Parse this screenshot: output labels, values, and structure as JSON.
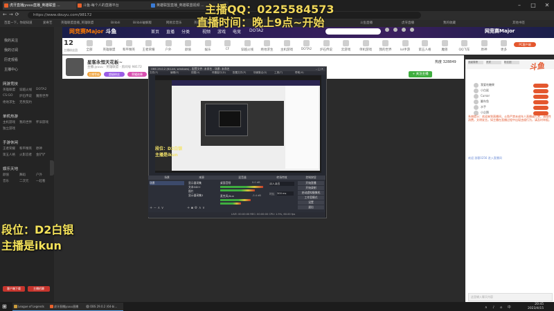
{
  "browser": {
    "tabs": [
      "虎牙直播jyuuu直播_英雄联盟 ...",
      "斗鱼-每个人的直播平台",
      "英雄联盟直播_英雄联盟视频 ..."
    ],
    "url": "https://www.douyu.com/98172",
    "bookmarks": [
      "百度一下，你就知道",
      "爱奇艺",
      "英雄联盟直播_英雄联盟",
      "Bilibili",
      "Bilibili破解版",
      "网易云音乐",
      "英雄联盟官方网站",
      "斗鱼直播",
      "虎牙直播",
      "我的收藏",
      "其他书签"
    ]
  },
  "site": {
    "logo_main": "斗鱼",
    "logo_sub": "网竞赛Major",
    "nav": [
      "首页",
      "直播",
      "分类",
      "视频",
      "游戏",
      "电竞",
      "DOTA2"
    ],
    "right_logo": "网竞赛Major"
  },
  "categories": {
    "count": "12",
    "count_sub": "主播粉丝团",
    "items": [
      "全部",
      "英雄联盟",
      "和平精英",
      "王者荣耀",
      "户外",
      "颜值",
      "娱乐",
      "CF",
      "穿越火线",
      "绝地求生",
      "主机游戏",
      "DOTA2",
      "炉石传说",
      "云游戏",
      "单机游戏",
      "我的世界",
      "lol手游",
      "第五人格",
      "魔兽",
      "QQ飞车",
      "原神",
      "更多"
    ],
    "promo": "PC客户端"
  },
  "overlay": {
    "qq_line": "主播QQ：0225584573",
    "time_line": "直播时间：晚上9点~开始",
    "rank_line": "段位：D2白银",
    "host_line": "主播是ikun"
  },
  "sidebar": {
    "top": [
      "我的关注",
      "我的订阅",
      "历史观看",
      "主播中心"
    ],
    "sections": [
      {
        "title": "网游竞技",
        "items": [
          "英雄联盟",
          "穿越火线",
          "DOTA2",
          "CS:GO",
          "炉石传说",
          "魔兽世界",
          "绝地求生",
          "无畏契约"
        ]
      },
      {
        "title": "单机热游",
        "items": [
          "主机游戏",
          "我的世界",
          "怀旧游戏",
          "独立游戏"
        ]
      },
      {
        "title": "手游休闲",
        "items": [
          "王者荣耀",
          "和平精英",
          "原神",
          "第五人格",
          "火影忍者",
          "金铲铲"
        ]
      },
      {
        "title": "娱乐天地",
        "items": [
          "颜值",
          "舞蹈",
          "户外",
          "音乐",
          "二次元",
          "一起看"
        ]
      }
    ],
    "buttons": [
      "客户端下载",
      "主播招募"
    ]
  },
  "room": {
    "title": "星客永恒天花板~",
    "sub": "主播:jyuuu · 英雄联盟 · 房间号 98172",
    "tags": [
      "主播等级",
      "超级粉丝",
      "荣耀勋章"
    ],
    "follow": "+ 关注主播",
    "viewers": "热度 328849"
  },
  "obs": {
    "title": "OBS 29.0.2 (64-bit, windows) - 配置文件: 未命名 - 场景: 未命名",
    "menu": [
      "文件(F)",
      "编辑(E)",
      "视图(V)",
      "停靠窗口(D)",
      "配置文件(P)",
      "场景集合(S)",
      "工具(T)",
      "帮助(H)"
    ],
    "docks": [
      "场景",
      "来源",
      "混音器",
      "转场特效",
      "控制按钮"
    ],
    "scene": "场景",
    "sources": [
      "显示器采集",
      "文本GDI+",
      "图片",
      "显示器采集2"
    ],
    "mixer": [
      "桌面音频",
      "麦克风/Aux"
    ],
    "db": [
      "0.0 dB",
      "-3.4 dB"
    ],
    "transition": "淡入淡出",
    "duration_label": "时长",
    "duration": "300 ms",
    "controls": [
      "开始直播",
      "开始录制",
      "启动虚拟摄像机",
      "工作室模式",
      "设置",
      "退出"
    ],
    "status": "LIVE: 00:00:00    REC: 00:00:00    CPU: 1.9%, 60.00 fps",
    "inner_rank": "段位：D2白银",
    "inner_host": "主播是ikun"
  },
  "chat": {
    "tabs": [
      "贡献周榜",
      "贵宾",
      "粉丝团"
    ],
    "rank_rows": [
      "我爱吃糖果",
      "小白鲨",
      "Cursor",
      "翻车鱼",
      "水手",
      "小企鹅"
    ],
    "notice": "系统提示：欢迎来到直播间，斗鱼严禁未成年人直播或打赏，请理性消费，文明发言。如主播在直播过程中出现违规行为，请及时举报。",
    "welcome": "欢迎 游客0256 进入直播间",
    "input_placeholder": "这里输入聊天内容",
    "brand": "斗鱼"
  },
  "taskbar": {
    "apps": [
      "League of Legends",
      "虎牙直播jyuuu直播",
      "OBS 29.0.2 (64-bi..."
    ],
    "time": "20:45",
    "date": "2023/4/15"
  }
}
